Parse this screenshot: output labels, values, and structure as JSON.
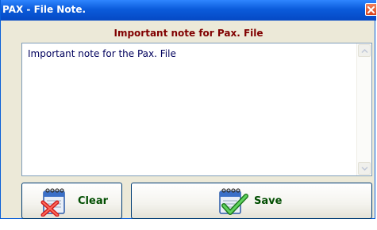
{
  "window": {
    "title": "PAX - File Note."
  },
  "header": {
    "label": "Important note for Pax. File"
  },
  "note": {
    "value": "Important note for the Pax. File"
  },
  "buttons": {
    "clear_label": "Clear",
    "save_label": "Save"
  },
  "icons": {
    "close": "close-icon",
    "scroll_up": "chevron-up-icon",
    "scroll_down": "chevron-down-icon",
    "clear": "notepad-delete-icon",
    "save": "notepad-check-icon"
  },
  "colors": {
    "title_bar": "#0b5bdb",
    "header_text": "#800000",
    "button_text": "#004d00"
  }
}
